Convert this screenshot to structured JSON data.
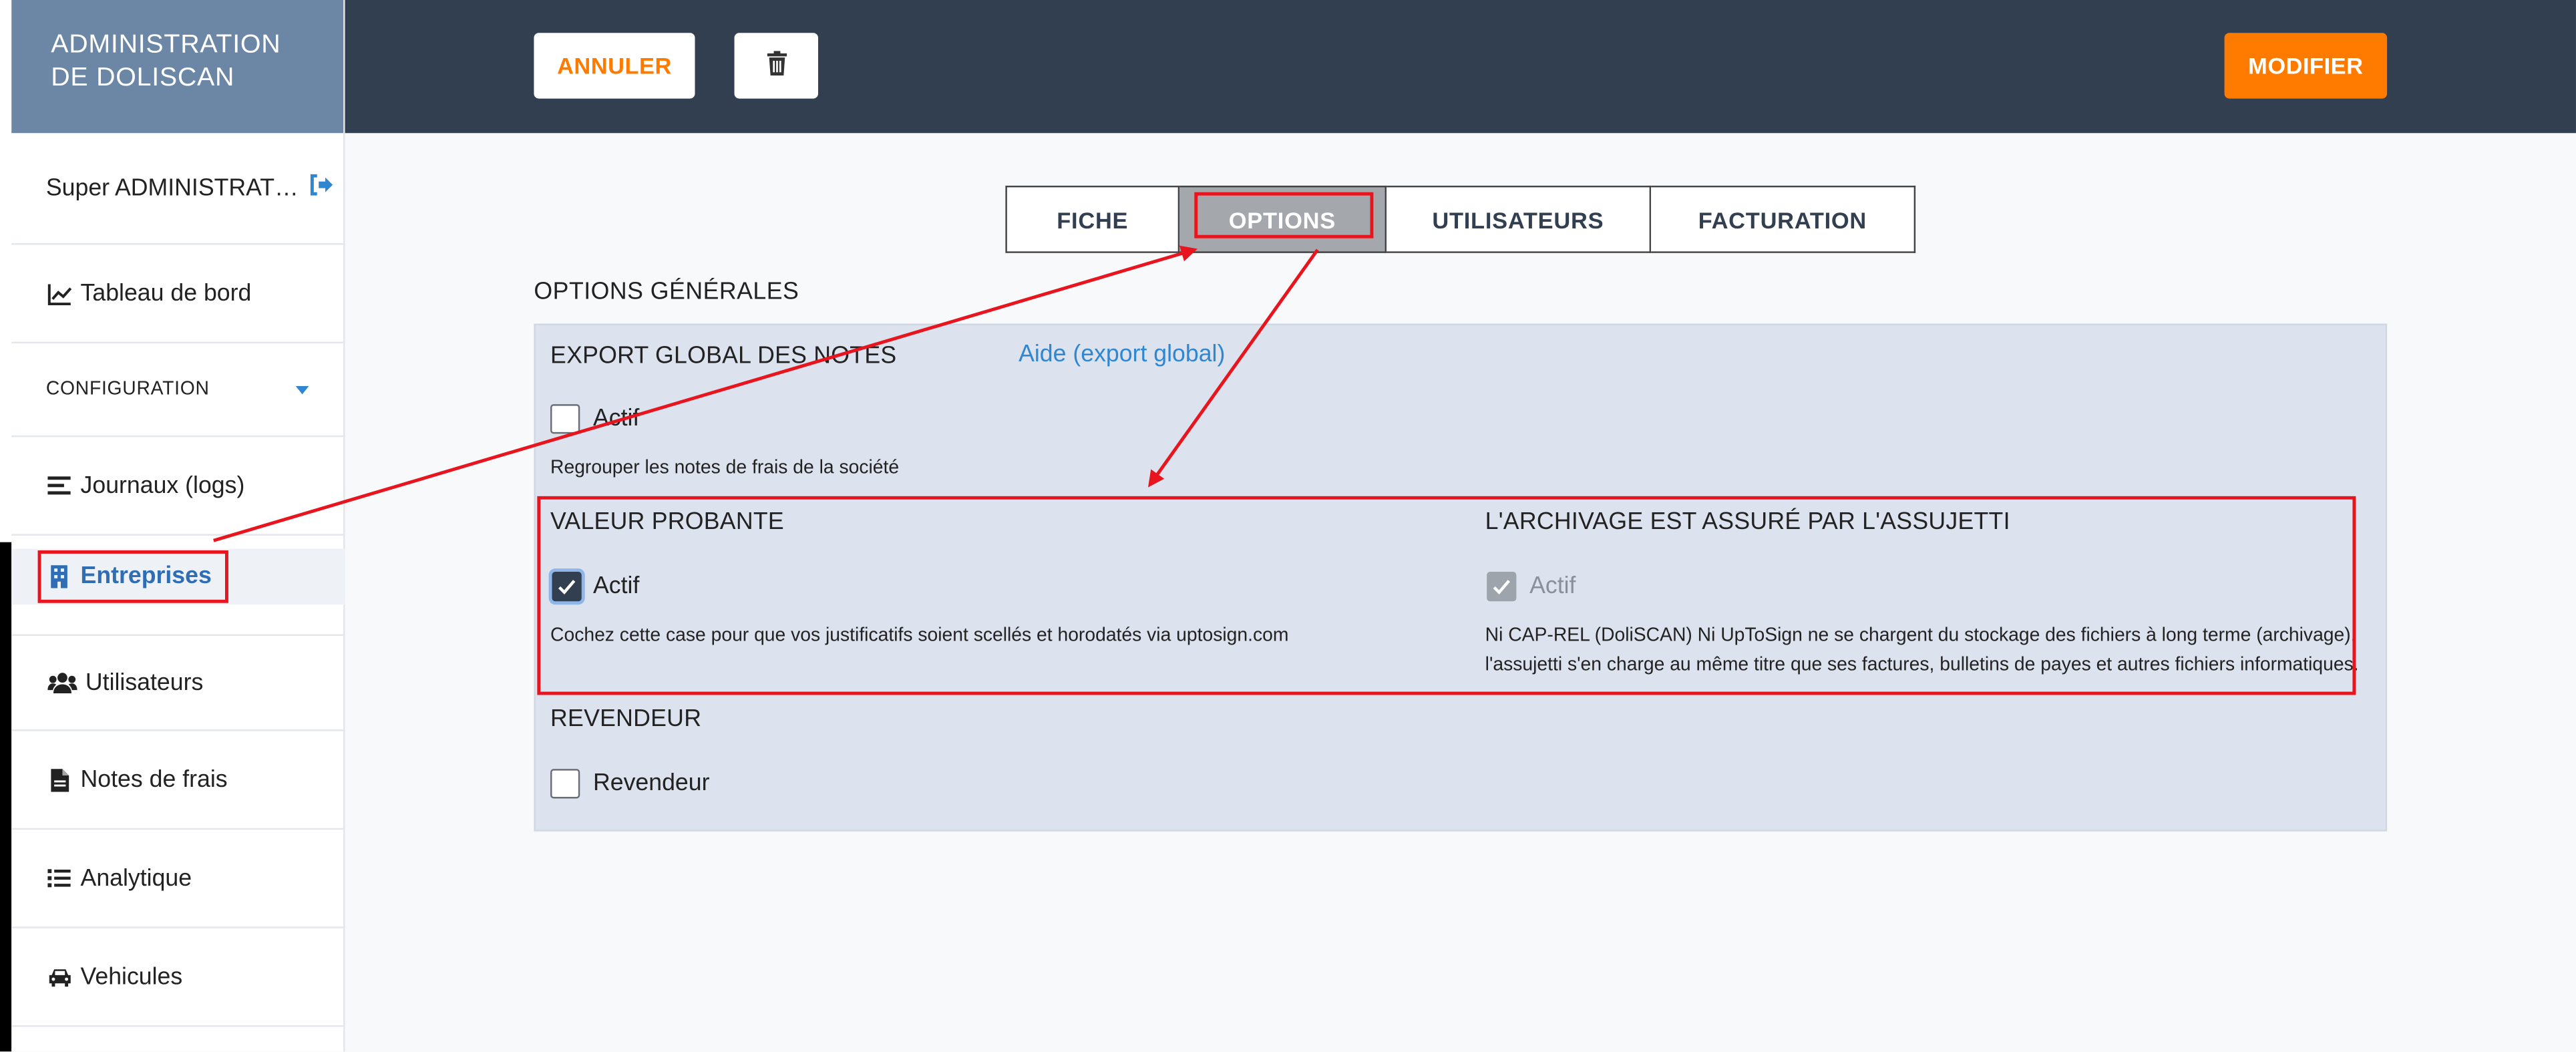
{
  "sidebar": {
    "title": "ADMINISTRATION DE DOLISCAN",
    "user": "Super ADMINISTRAT…",
    "items": [
      {
        "label": "Tableau de bord",
        "icon": "chart-line-icon"
      },
      {
        "label": "CONFIGURATION",
        "icon": "chevron-down-icon"
      },
      {
        "label": "Journaux (logs)",
        "icon": "list-icon"
      },
      {
        "label": "Entreprises",
        "icon": "building-icon"
      },
      {
        "label": "Utilisateurs",
        "icon": "users-icon"
      },
      {
        "label": "Notes de frais",
        "icon": "document-icon"
      },
      {
        "label": "Analytique",
        "icon": "list-bullets-icon"
      },
      {
        "label": "Vehicules",
        "icon": "car-icon"
      }
    ]
  },
  "toolbar": {
    "cancel_label": "ANNULER",
    "modify_label": "MODIFIER"
  },
  "tabs": [
    "FICHE",
    "OPTIONS",
    "UTILISATEURS",
    "FACTURATION"
  ],
  "active_tab": "OPTIONS",
  "options": {
    "section_title": "OPTIONS GÉNÉRALES",
    "export": {
      "title": "EXPORT GLOBAL DES NOTES",
      "help_link": "Aide (export global)",
      "checkbox_label": "Actif",
      "checked": false,
      "description": "Regrouper les notes de frais de la société"
    },
    "valeur": {
      "title": "VALEUR PROBANTE",
      "checkbox_label": "Actif",
      "checked": true,
      "description": "Cochez cette case pour que vos justificatifs soient scellés et horodatés via uptosign.com"
    },
    "archivage": {
      "title": "L'ARCHIVAGE EST ASSURÉ PAR L'ASSUJETTI",
      "checkbox_label": "Actif",
      "checked": true,
      "disabled": true,
      "description_line1": "Ni CAP-REL (DoliSCAN) Ni UpToSign ne se chargent du stockage des fichiers à long terme (archivage),",
      "description_line2": "l'assujetti s'en charge au même titre que ses factures, bulletins de payes et autres fichiers informatiques."
    },
    "revendeur": {
      "title": "REVENDEUR",
      "checkbox_label": "Revendeur",
      "checked": false
    }
  },
  "colors": {
    "sidebar_header": "#6c87a6",
    "topbar": "#323f51",
    "accent_orange": "#ff7b00",
    "link_blue": "#2f86d1",
    "panel_bg": "#dce3ee",
    "annotation_red": "#e8141e"
  }
}
